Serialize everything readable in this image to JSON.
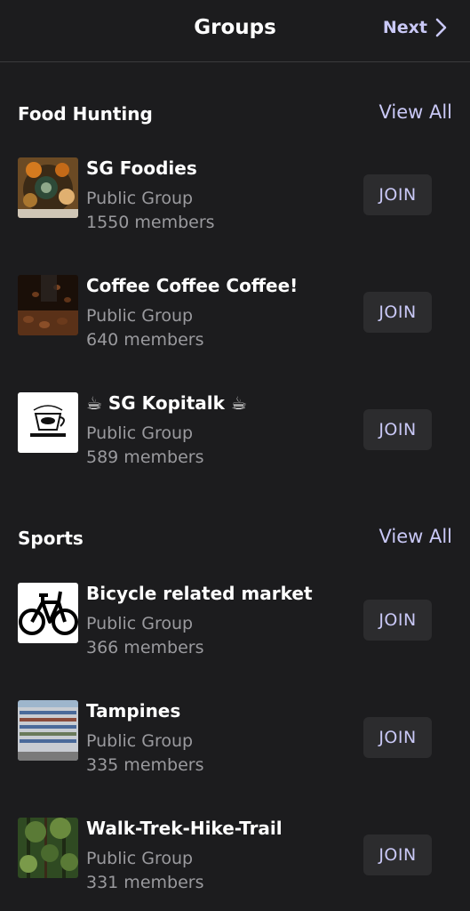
{
  "header": {
    "title": "Groups",
    "next_label": "Next",
    "next_icon": "chevron-right-icon"
  },
  "sections": [
    {
      "title": "Food Hunting",
      "view_all": "View All",
      "groups": [
        {
          "name": "SG Foodies",
          "type": "Public Group",
          "members": "1550 members",
          "join": "JOIN"
        },
        {
          "name": "Coffee Coffee Coffee!",
          "type": "Public Group",
          "members": "640 members",
          "join": "JOIN"
        },
        {
          "name": "☕ SG Kopitalk ☕",
          "type": "Public Group",
          "members": "589 members",
          "join": "JOIN"
        }
      ]
    },
    {
      "title": "Sports",
      "view_all": "View All",
      "groups": [
        {
          "name": "Bicycle related market",
          "type": "Public Group",
          "members": "366 members",
          "join": "JOIN"
        },
        {
          "name": "Tampines",
          "type": "Public Group",
          "members": "335 members",
          "join": "JOIN"
        },
        {
          "name": "Walk-Trek-Hike-Trail",
          "type": "Public Group",
          "members": "331 members",
          "join": "JOIN"
        }
      ]
    }
  ],
  "colors": {
    "background": "#1c1c1e",
    "accent": "#c9c8f6",
    "secondary_text": "#9a9a9e",
    "button_bg": "#2c2c2e"
  }
}
